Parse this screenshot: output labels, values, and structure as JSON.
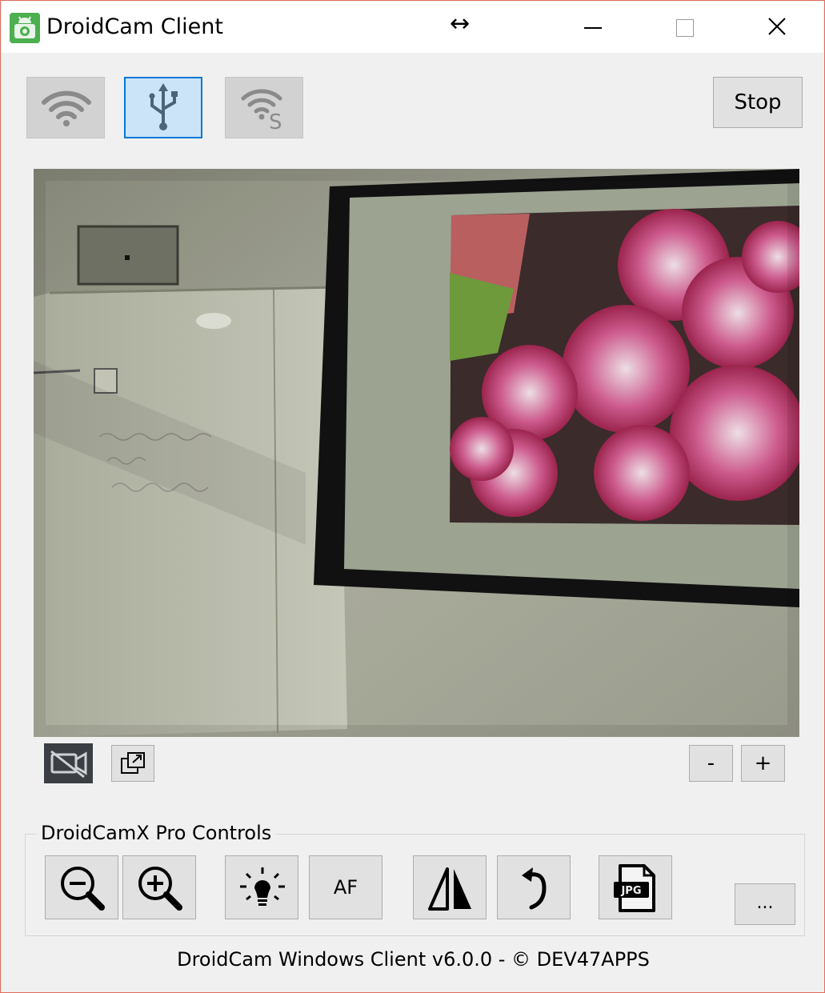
{
  "window": {
    "title": "DroidCam Client",
    "resize_glyph": "↔",
    "controls": [
      "minimize-icon",
      "maximize-icon",
      "close-icon"
    ],
    "border_color": "#e06c5c"
  },
  "connection_modes": [
    {
      "name": "wifi",
      "icon": "wifi-icon",
      "active": false
    },
    {
      "name": "usb",
      "icon": "usb-icon",
      "active": true
    },
    {
      "name": "wifi-server",
      "icon": "wifi-server-icon",
      "active": false
    }
  ],
  "toolbar": {
    "stop_label": "Stop"
  },
  "preview_controls": {
    "camera_off_icon": "video-off-icon",
    "popout_icon": "popout-window-icon",
    "zoom_minus_label": "-",
    "zoom_plus_label": "+"
  },
  "pro_controls": {
    "label": "DroidCamX Pro Controls",
    "buttons": [
      {
        "name": "zoom-out",
        "icon": "zoom-out-icon"
      },
      {
        "name": "zoom-in",
        "icon": "zoom-in-icon"
      },
      {
        "name": "light",
        "icon": "flashlight-icon"
      },
      {
        "name": "autofocus",
        "label": "AF"
      },
      {
        "name": "mirror",
        "icon": "flip-icon"
      },
      {
        "name": "rotate",
        "icon": "rotate-icon"
      },
      {
        "name": "snapshot",
        "icon": "jpg-file-icon",
        "icon_text": "JPG"
      }
    ],
    "more_label": "..."
  },
  "footer": {
    "text": "DroidCam Windows Client v6.0.0 - © DEV47APPS"
  },
  "colors": {
    "active_border": "#0078d7",
    "active_fill": "#cce4f7",
    "app_icon_green": "#4caf50"
  }
}
